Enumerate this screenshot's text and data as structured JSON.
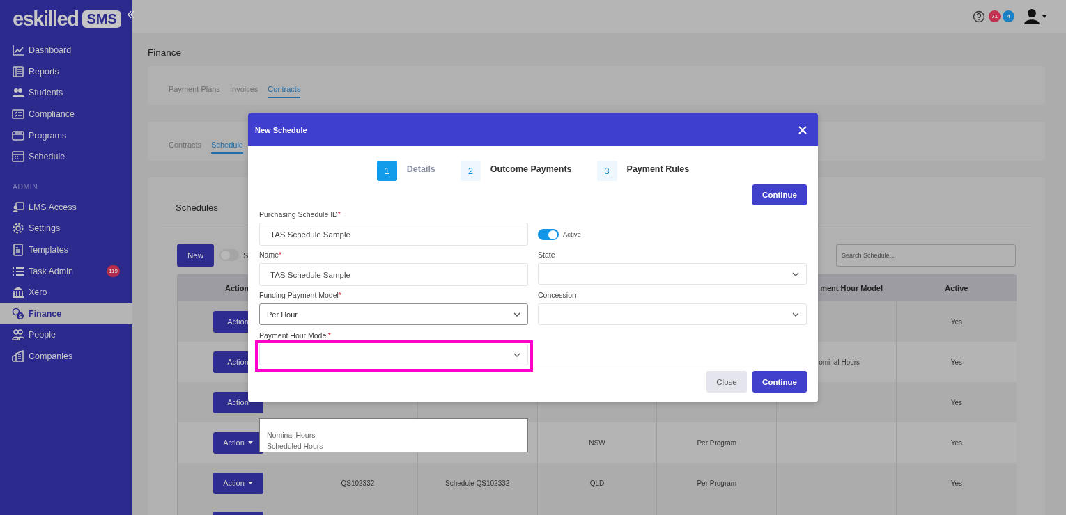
{
  "sidebar": {
    "logo": {
      "word": "eskilled",
      "badge": "SMS"
    },
    "items": [
      {
        "label": "Dashboard",
        "selected": false
      },
      {
        "label": "Reports",
        "selected": false
      },
      {
        "label": "Students",
        "selected": false
      },
      {
        "label": "Compliance",
        "selected": false
      },
      {
        "label": "Programs",
        "selected": false
      },
      {
        "label": "Schedule",
        "selected": false
      }
    ],
    "admin_heading": "ADMIN",
    "admin_items": [
      {
        "label": "LMS Access",
        "selected": false
      },
      {
        "label": "Settings",
        "selected": false
      },
      {
        "label": "Templates",
        "selected": false
      },
      {
        "label": "Task Admin",
        "selected": false,
        "badge": "119"
      },
      {
        "label": "Xero",
        "selected": false
      },
      {
        "label": "Finance",
        "selected": true
      },
      {
        "label": "People",
        "selected": false
      },
      {
        "label": "Companies",
        "selected": false
      }
    ]
  },
  "topbar": {
    "badges": [
      {
        "count": "71",
        "color": "#c0304f"
      },
      {
        "count": "4",
        "color": "#1a7fc4"
      }
    ]
  },
  "page_title": "Finance",
  "tabs": [
    {
      "label": "Payment Plans",
      "selected": false
    },
    {
      "label": "Invoices",
      "selected": false
    },
    {
      "label": "Contracts",
      "selected": true
    }
  ],
  "sub_tabs": [
    {
      "label": "Contracts",
      "selected": false
    },
    {
      "label": "Schedule",
      "selected": true
    }
  ],
  "schedules": {
    "title": "Schedules",
    "new_button": "New",
    "toggle": {
      "on": false,
      "label": "S"
    },
    "search": {
      "placeholder": "Search Schedule..."
    },
    "table": {
      "action_column": "Action",
      "columns": [
        null,
        null,
        null,
        null,
        "ment Hour Model",
        "Active"
      ],
      "rows": [
        {
          "action": {
            "label": "Action",
            "caret": false
          },
          "cells": [
            null,
            null,
            null,
            null,
            null,
            "Yes"
          ]
        },
        {
          "action": {
            "label": "Action",
            "caret": false
          },
          "cells": [
            null,
            null,
            null,
            null,
            "ominal Hours",
            "Yes"
          ]
        },
        {
          "action": {
            "label": "Action",
            "caret": false
          },
          "cells": [
            null,
            null,
            null,
            null,
            null,
            "Yes"
          ]
        },
        {
          "action": {
            "label": "Action",
            "caret": true
          },
          "cells": [
            null,
            null,
            "NSW",
            "Per Program",
            null,
            "Yes"
          ]
        },
        {
          "action": {
            "label": "Action",
            "caret": true
          },
          "cells": [
            "QS102332",
            "Schedule QS102332",
            "QLD",
            "Per Program",
            null,
            "Yes"
          ]
        }
      ]
    }
  },
  "modal": {
    "title": "New Schedule",
    "steps": [
      {
        "number": "1",
        "label": "Details",
        "selected": true
      },
      {
        "number": "2",
        "label": "Outcome Payments",
        "selected": false
      },
      {
        "number": "3",
        "label": "Payment Rules",
        "selected": false
      }
    ],
    "top_button": "Continue",
    "form_rows": [
      {
        "left": {
          "kind": "text",
          "label": "Purchasing Schedule ID",
          "required_mark": "*",
          "value": "TAS Schedule Sample"
        },
        "right": {
          "kind": "switch",
          "label": "Active",
          "on": true
        }
      },
      {
        "left": {
          "kind": "text",
          "label": "Name",
          "required_mark": "*",
          "value": "TAS Schedule Sample"
        },
        "right": {
          "kind": "select",
          "label": "State"
        }
      },
      {
        "left": {
          "kind": "select",
          "label": "Funding Payment Model",
          "required_mark": "*",
          "value": "Per Hour",
          "focused": true
        },
        "right": {
          "kind": "select",
          "label": "Concession"
        }
      },
      {
        "left": {
          "kind": "select",
          "label": "Payment Hour Model",
          "required_mark": "*",
          "highlighted": true
        }
      }
    ],
    "buttons": [
      {
        "label": "Close",
        "kind": "secondary"
      },
      {
        "label": "Continue",
        "kind": "primary"
      }
    ]
  },
  "dropdown": {
    "options": [
      "Nominal Hours",
      "Scheduled Hours"
    ]
  }
}
